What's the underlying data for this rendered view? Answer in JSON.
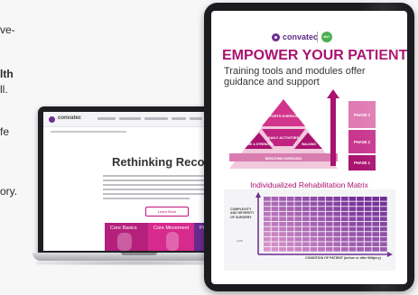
{
  "background_text": {
    "lines": [
      "ve-",
      "lth",
      "ll.",
      "fe",
      "ory."
    ],
    "bold": [
      false,
      true,
      false,
      false,
      false
    ]
  },
  "laptop": {
    "brand": "convatec",
    "headline": "Rethinking Recovery",
    "button_label": "Learn More",
    "tiles": [
      {
        "label": "Core Basics",
        "color": "#b5207d"
      },
      {
        "label": "Core Movement",
        "color": "#d62a8e"
      },
      {
        "label": "Progress",
        "color": "#6a2a8f"
      }
    ]
  },
  "tablet": {
    "brand": "convatec",
    "badge": "Me+",
    "headline": "EMPOWER YOUR PATIENTS",
    "subheadline": "Training tools and modules offer guidance and support",
    "pyramid": {
      "base_label": "BREATHING EXERCISES",
      "middle_left": "CORE & STRENGTH",
      "middle_right": "WALKING",
      "center": "DAILY ACTIVITIES",
      "top": "SPORTS EXERCISE"
    },
    "phases": [
      "PHASE 1",
      "PHASE 2",
      "PHASE 3"
    ],
    "matrix_title": "Individualized Rehabilitation Matrix",
    "matrix_ylabel": "COMPLEXITY AND SEVERITY OF SURGERY",
    "matrix_xlabel": "CONDITION OF PATIENT (before or after surgery)",
    "matrix_left_label": "LOW",
    "matrix_right_label": "HIGH",
    "accent_color": "#a9126f",
    "brand_color": "#5a2c82"
  }
}
